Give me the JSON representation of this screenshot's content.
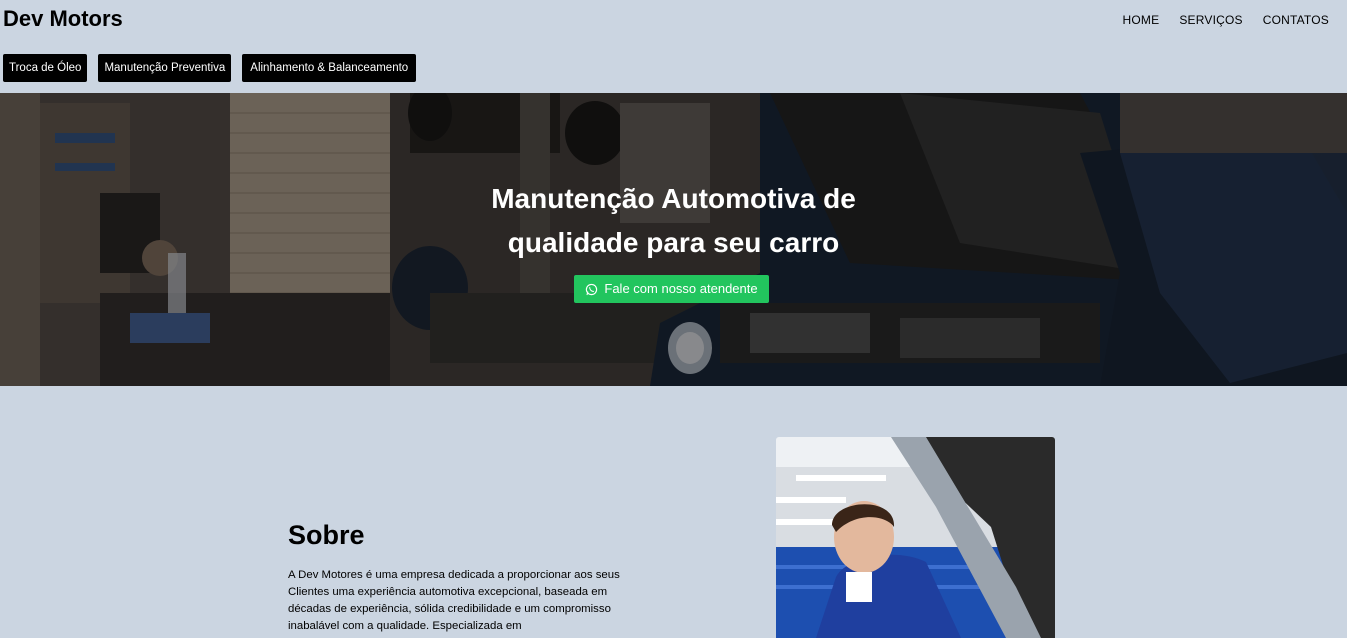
{
  "brand": "Dev Motors",
  "nav": [
    "HOME",
    "SERVIÇOS",
    "CONTATOS"
  ],
  "services": [
    "Troca de Óleo",
    "Manutenção Preventiva",
    "Alinhamento & Balanceamento"
  ],
  "hero": {
    "title_line1": "Manutenção Automotiva de",
    "title_line2": "qualidade para seu carro",
    "cta_label": "Fale com nosso atendente",
    "cta_icon": "whatsapp-icon",
    "cta_color": "#22c55e"
  },
  "about": {
    "title": "Sobre",
    "text": "A Dev Motores é uma empresa dedicada a proporcionar aos seus Clientes uma experiência automotiva excepcional, baseada em décadas de experiência, sólida credibilidade e um compromisso inabalável com a qualidade. Especializada em"
  },
  "colors": {
    "page_background": "#cbd5e1",
    "button_background": "#000000",
    "button_text": "#ffffff"
  }
}
